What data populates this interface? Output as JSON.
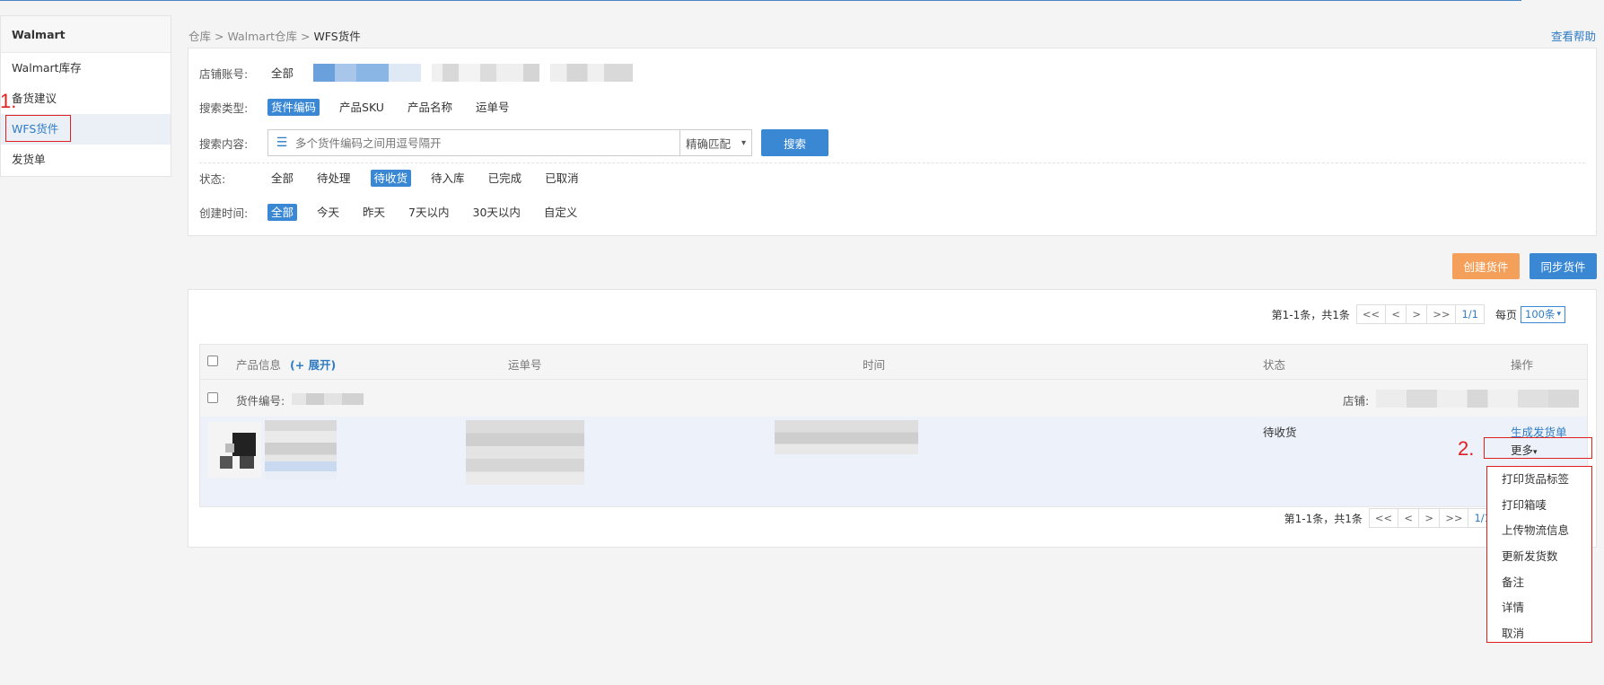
{
  "sidebar": {
    "header": "Walmart",
    "items": [
      {
        "label": "Walmart库存"
      },
      {
        "label": "备货建议"
      },
      {
        "label": "WFS货件"
      },
      {
        "label": "发货单"
      }
    ]
  },
  "annotations": {
    "step1": "1.",
    "step2": "2."
  },
  "breadcrumb": {
    "part1": "仓库",
    "sep": " > ",
    "part2": "Walmart仓库",
    "current": "WFS货件"
  },
  "help_link": "查看帮助",
  "filters": {
    "store_label": "店铺账号:",
    "store_all": "全部",
    "search_type_label": "搜索类型:",
    "search_types": [
      "货件编码",
      "产品SKU",
      "产品名称",
      "运单号"
    ],
    "search_content_label": "搜索内容:",
    "search_placeholder": "多个货件编码之间用逗号隔开",
    "match_mode": "精确匹配",
    "search_button": "搜索",
    "status_label": "状态:",
    "statuses": [
      "全部",
      "待处理",
      "待收货",
      "待入库",
      "已完成",
      "已取消"
    ],
    "created_label": "创建时间:",
    "created_options": [
      "全部",
      "今天",
      "昨天",
      "7天以内",
      "30天以内",
      "自定义"
    ]
  },
  "actions": {
    "create": "创建货件",
    "sync": "同步货件"
  },
  "pager": {
    "summary": "第1-1条，共1条",
    "first": "<<",
    "prev": "<",
    "next": ">",
    "last": ">>",
    "page": "1/1",
    "per_page_label": "每页",
    "per_page_value": "100条"
  },
  "table": {
    "headers": {
      "product": "产品信息",
      "expand": "(+ 展开)",
      "tracking": "运单号",
      "time": "时间",
      "status": "状态",
      "ops": "操作"
    },
    "shipment_label": "货件编号:",
    "store_label": "店铺:",
    "row": {
      "status": "待收货",
      "generate": "生成发货单",
      "more": "更多"
    }
  },
  "more_menu": [
    "打印货品标签",
    "打印箱唛",
    "上传物流信息",
    "更新发货数",
    "备注",
    "详情",
    "取消"
  ]
}
